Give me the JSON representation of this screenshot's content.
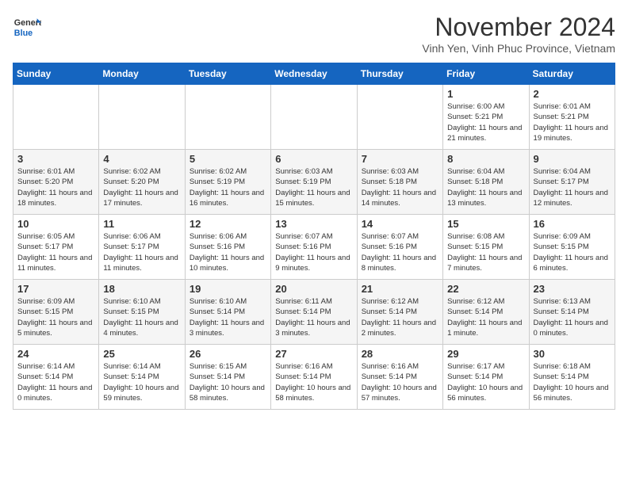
{
  "header": {
    "logo_line1": "General",
    "logo_line2": "Blue",
    "month": "November 2024",
    "location": "Vinh Yen, Vinh Phuc Province, Vietnam"
  },
  "days_of_week": [
    "Sunday",
    "Monday",
    "Tuesday",
    "Wednesday",
    "Thursday",
    "Friday",
    "Saturday"
  ],
  "weeks": [
    [
      {
        "num": "",
        "detail": ""
      },
      {
        "num": "",
        "detail": ""
      },
      {
        "num": "",
        "detail": ""
      },
      {
        "num": "",
        "detail": ""
      },
      {
        "num": "",
        "detail": ""
      },
      {
        "num": "1",
        "detail": "Sunrise: 6:00 AM\nSunset: 5:21 PM\nDaylight: 11 hours and 21 minutes."
      },
      {
        "num": "2",
        "detail": "Sunrise: 6:01 AM\nSunset: 5:21 PM\nDaylight: 11 hours and 19 minutes."
      }
    ],
    [
      {
        "num": "3",
        "detail": "Sunrise: 6:01 AM\nSunset: 5:20 PM\nDaylight: 11 hours and 18 minutes."
      },
      {
        "num": "4",
        "detail": "Sunrise: 6:02 AM\nSunset: 5:20 PM\nDaylight: 11 hours and 17 minutes."
      },
      {
        "num": "5",
        "detail": "Sunrise: 6:02 AM\nSunset: 5:19 PM\nDaylight: 11 hours and 16 minutes."
      },
      {
        "num": "6",
        "detail": "Sunrise: 6:03 AM\nSunset: 5:19 PM\nDaylight: 11 hours and 15 minutes."
      },
      {
        "num": "7",
        "detail": "Sunrise: 6:03 AM\nSunset: 5:18 PM\nDaylight: 11 hours and 14 minutes."
      },
      {
        "num": "8",
        "detail": "Sunrise: 6:04 AM\nSunset: 5:18 PM\nDaylight: 11 hours and 13 minutes."
      },
      {
        "num": "9",
        "detail": "Sunrise: 6:04 AM\nSunset: 5:17 PM\nDaylight: 11 hours and 12 minutes."
      }
    ],
    [
      {
        "num": "10",
        "detail": "Sunrise: 6:05 AM\nSunset: 5:17 PM\nDaylight: 11 hours and 11 minutes."
      },
      {
        "num": "11",
        "detail": "Sunrise: 6:06 AM\nSunset: 5:17 PM\nDaylight: 11 hours and 11 minutes."
      },
      {
        "num": "12",
        "detail": "Sunrise: 6:06 AM\nSunset: 5:16 PM\nDaylight: 11 hours and 10 minutes."
      },
      {
        "num": "13",
        "detail": "Sunrise: 6:07 AM\nSunset: 5:16 PM\nDaylight: 11 hours and 9 minutes."
      },
      {
        "num": "14",
        "detail": "Sunrise: 6:07 AM\nSunset: 5:16 PM\nDaylight: 11 hours and 8 minutes."
      },
      {
        "num": "15",
        "detail": "Sunrise: 6:08 AM\nSunset: 5:15 PM\nDaylight: 11 hours and 7 minutes."
      },
      {
        "num": "16",
        "detail": "Sunrise: 6:09 AM\nSunset: 5:15 PM\nDaylight: 11 hours and 6 minutes."
      }
    ],
    [
      {
        "num": "17",
        "detail": "Sunrise: 6:09 AM\nSunset: 5:15 PM\nDaylight: 11 hours and 5 minutes."
      },
      {
        "num": "18",
        "detail": "Sunrise: 6:10 AM\nSunset: 5:15 PM\nDaylight: 11 hours and 4 minutes."
      },
      {
        "num": "19",
        "detail": "Sunrise: 6:10 AM\nSunset: 5:14 PM\nDaylight: 11 hours and 3 minutes."
      },
      {
        "num": "20",
        "detail": "Sunrise: 6:11 AM\nSunset: 5:14 PM\nDaylight: 11 hours and 3 minutes."
      },
      {
        "num": "21",
        "detail": "Sunrise: 6:12 AM\nSunset: 5:14 PM\nDaylight: 11 hours and 2 minutes."
      },
      {
        "num": "22",
        "detail": "Sunrise: 6:12 AM\nSunset: 5:14 PM\nDaylight: 11 hours and 1 minute."
      },
      {
        "num": "23",
        "detail": "Sunrise: 6:13 AM\nSunset: 5:14 PM\nDaylight: 11 hours and 0 minutes."
      }
    ],
    [
      {
        "num": "24",
        "detail": "Sunrise: 6:14 AM\nSunset: 5:14 PM\nDaylight: 11 hours and 0 minutes."
      },
      {
        "num": "25",
        "detail": "Sunrise: 6:14 AM\nSunset: 5:14 PM\nDaylight: 10 hours and 59 minutes."
      },
      {
        "num": "26",
        "detail": "Sunrise: 6:15 AM\nSunset: 5:14 PM\nDaylight: 10 hours and 58 minutes."
      },
      {
        "num": "27",
        "detail": "Sunrise: 6:16 AM\nSunset: 5:14 PM\nDaylight: 10 hours and 58 minutes."
      },
      {
        "num": "28",
        "detail": "Sunrise: 6:16 AM\nSunset: 5:14 PM\nDaylight: 10 hours and 57 minutes."
      },
      {
        "num": "29",
        "detail": "Sunrise: 6:17 AM\nSunset: 5:14 PM\nDaylight: 10 hours and 56 minutes."
      },
      {
        "num": "30",
        "detail": "Sunrise: 6:18 AM\nSunset: 5:14 PM\nDaylight: 10 hours and 56 minutes."
      }
    ]
  ]
}
